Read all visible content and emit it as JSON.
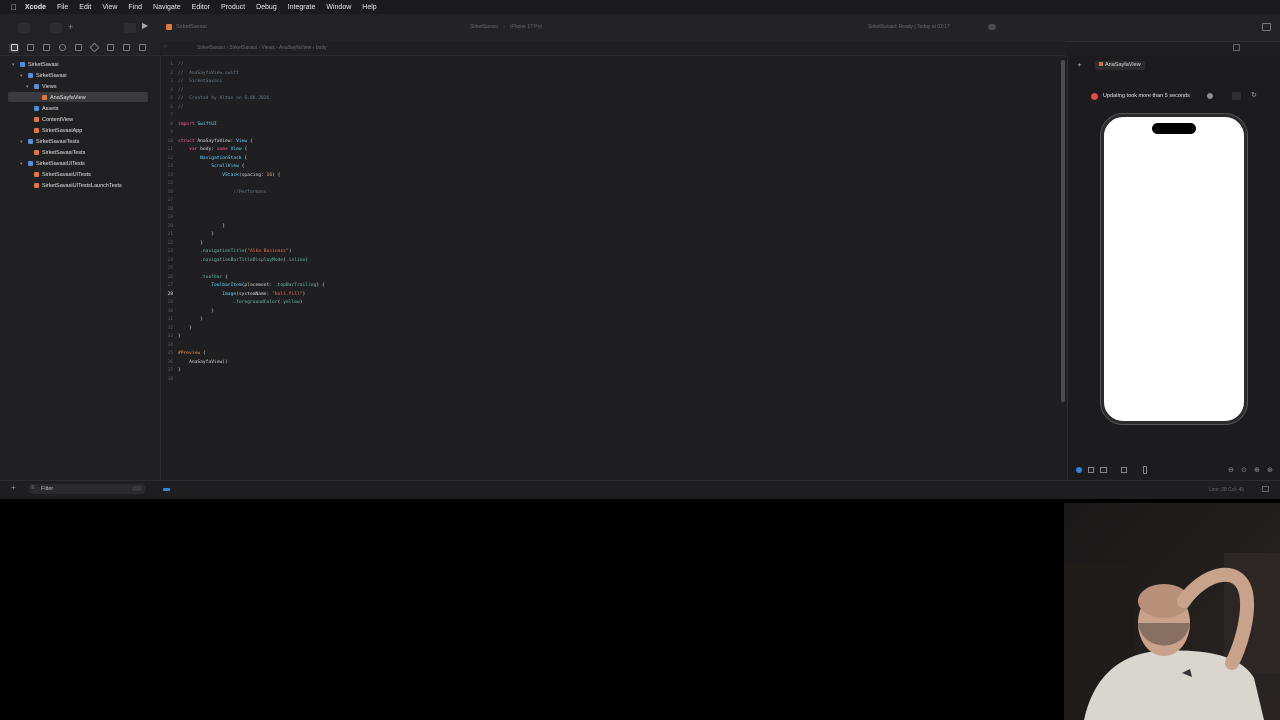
{
  "menubar": {
    "items": [
      "Xcode",
      "File",
      "Edit",
      "View",
      "Find",
      "Navigate",
      "Editor",
      "Product",
      "Debug",
      "Integrate",
      "Window",
      "Help"
    ]
  },
  "toolbar": {
    "project": "SirketSavasi",
    "scheme": "SirketSavasi",
    "destination": "iPhone 17 Pro",
    "status": "SirketSavasi: Ready | Today at 02:17"
  },
  "jumpbar": {
    "path": [
      "SirketSavasi",
      "SirketSavasi",
      "Views",
      "AnaSayfaView",
      "body"
    ]
  },
  "navigator": {
    "items": [
      {
        "label": "SirketSavasi",
        "level": 0,
        "icon": "project-icon"
      },
      {
        "label": "SirketSavasi",
        "level": 1,
        "icon": "folder-icon"
      },
      {
        "label": "Views",
        "level": 2,
        "icon": "folder-icon"
      },
      {
        "label": "AnaSayfaView",
        "level": 3,
        "icon": "swift-file-icon"
      },
      {
        "label": "Assets",
        "level": 2,
        "icon": "assets-icon"
      },
      {
        "label": "ContentView",
        "level": 2,
        "icon": "swift-file-icon"
      },
      {
        "label": "SirketSavasiApp",
        "level": 2,
        "icon": "swift-file-icon"
      },
      {
        "label": "SirketSavasiTests",
        "level": 1,
        "icon": "folder-icon"
      },
      {
        "label": "SirketSavasiTests",
        "level": 2,
        "icon": "swift-file-icon"
      },
      {
        "label": "SirketSavasiUITests",
        "level": 1,
        "icon": "folder-icon"
      },
      {
        "label": "SirketSavasiUITests",
        "level": 2,
        "icon": "swift-file-icon"
      },
      {
        "label": "SirketSavasiUITestsLaunchTests",
        "level": 2,
        "icon": "swift-file-icon"
      }
    ],
    "filter_placeholder": "Filter"
  },
  "code": {
    "lines": [
      "//",
      "//  AnaSayfaView.swift",
      "//  SirketSavasi",
      "//",
      "//  Created by Altan on 6.06.2026.",
      "//",
      "",
      "import SwiftUI",
      "",
      "struct AnaSayfaView: View {",
      "    var body: some View {",
      "        NavigationStack {",
      "            ScrollView {",
      "                VStack(spacing: 16) {",
      "",
      "                    //Performans",
      "",
      "",
      "",
      "                }",
      "            }",
      "        }",
      "        .navigationTitle(\"Alka Business\")",
      "        .navigationBarTitleDisplayMode(.inline)",
      "",
      "        .toolbar {",
      "            ToolbarItem(placement: .topBarTrailing) {",
      "                Image(systemName: \"bell.fill\")",
      "                    .foregroundColor(.yellow)",
      "            }",
      "        }",
      "    }",
      "}",
      "",
      "#Preview {",
      "    AnaSayfaView()",
      "}",
      ""
    ],
    "current_line": 28
  },
  "canvas": {
    "tab": "AnaSayfaView",
    "warning": "Updating took more than 5 seconds"
  },
  "statusbar": {
    "cursor": "Line: 28  Col: 45"
  },
  "colors": {
    "keyword": "#fc5fa3",
    "type": "#5dd8ff",
    "string": "#fc6a5d",
    "comment": "#6c7986",
    "number": "#d0bf69",
    "selection": "#3a3a3e"
  }
}
